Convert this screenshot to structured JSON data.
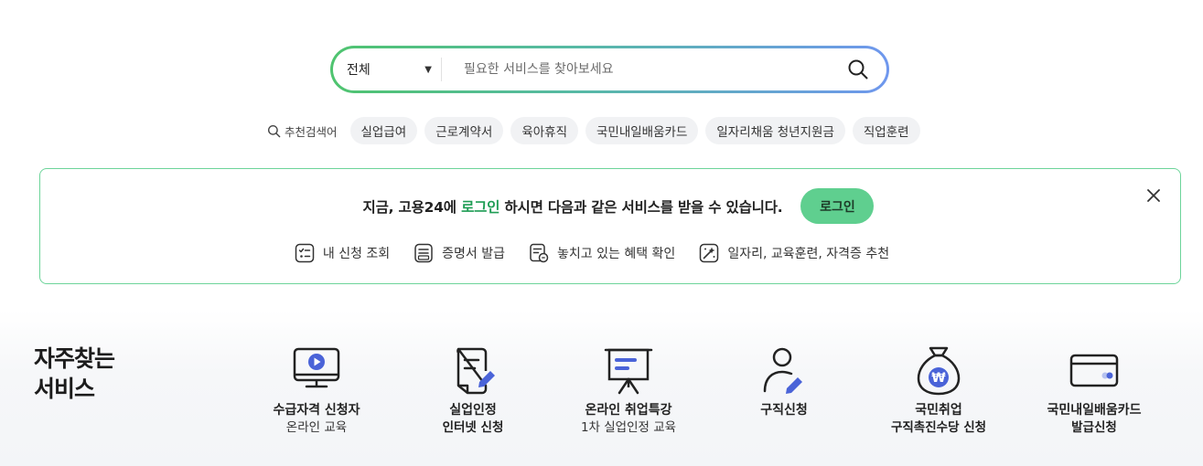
{
  "search": {
    "scope": "전체",
    "placeholder": "필요한 서비스를 찾아보세요",
    "value": ""
  },
  "recommended": {
    "label": "추천검색어",
    "keywords": [
      "실업급여",
      "근로계약서",
      "육아휴직",
      "국민내일배움카드",
      "일자리채움 청년지원금",
      "직업훈련"
    ]
  },
  "banner": {
    "text_before": "지금, 고용24에 ",
    "text_highlight": "로그인",
    "text_after": " 하시면 다음과 같은 서비스를 받을 수 있습니다.",
    "login_label": "로그인",
    "features": [
      {
        "icon": "checklist-icon",
        "label": "내 신청 조회"
      },
      {
        "icon": "certificate-icon",
        "label": "증명서 발급"
      },
      {
        "icon": "benefit-check-icon",
        "label": "놓치고 있는 혜택 확인"
      },
      {
        "icon": "recommend-icon",
        "label": "일자리, 교육훈련, 자격증 추천"
      }
    ]
  },
  "frequent": {
    "title_line1": "자주찾는",
    "title_line2": "서비스",
    "items": [
      {
        "icon": "monitor-play-icon",
        "line1": "수급자격 신청자",
        "line2": "온라인 교육",
        "line2_bold": false
      },
      {
        "icon": "document-edit-icon",
        "line1": "실업인정",
        "line2": "인터넷 신청",
        "line2_bold": true
      },
      {
        "icon": "presentation-board-icon",
        "line1": "온라인 취업특강",
        "line2": "1차 실업인정 교육",
        "line2_bold": false
      },
      {
        "icon": "person-edit-icon",
        "line1": "구직신청",
        "line2": "",
        "line2_bold": false
      },
      {
        "icon": "money-bag-icon",
        "line1": "국민취업",
        "line2": "구직촉진수당 신청",
        "line2_bold": true
      },
      {
        "icon": "card-icon",
        "line1": "국민내일배움카드",
        "line2": "발급신청",
        "line2_bold": true
      }
    ]
  },
  "colors": {
    "accent_green": "#5fcf8f",
    "highlight_green": "#1f9d55",
    "icon_blue": "#4a63d8",
    "border_green": "#6dd49a"
  }
}
